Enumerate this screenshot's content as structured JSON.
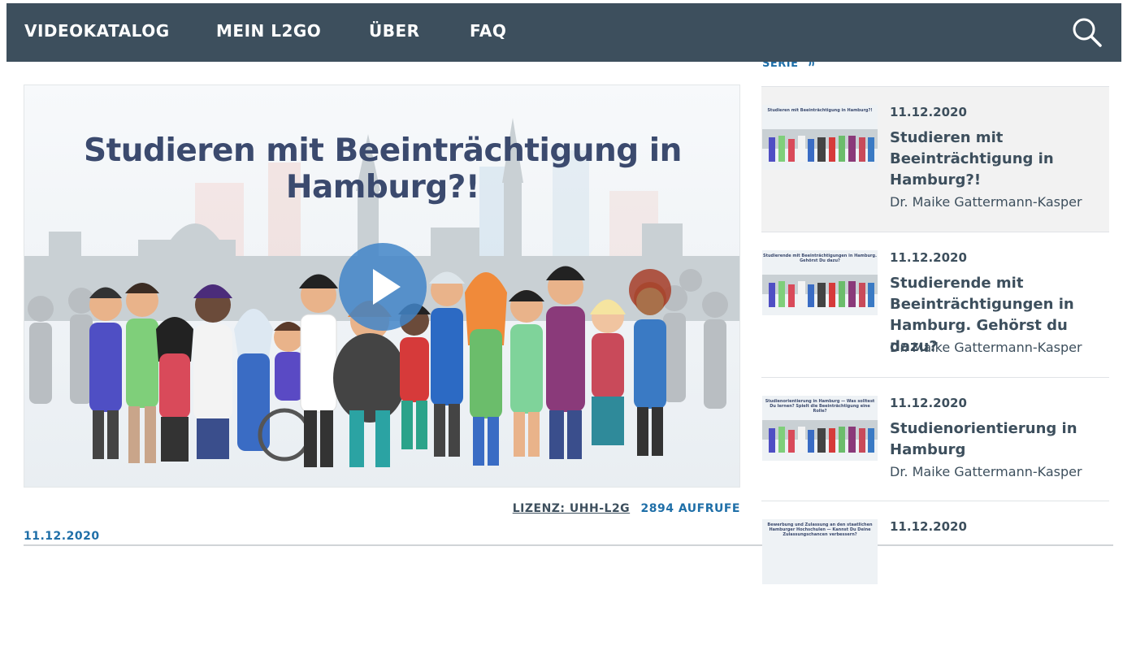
{
  "nav": {
    "items": [
      "VIDEOKATALOG",
      "MEIN L2GO",
      "ÜBER",
      "FAQ"
    ],
    "search_icon": "search-icon"
  },
  "series_link": "SERIE",
  "player": {
    "title": "Studieren mit Beeinträchtigung in Hamburg?!",
    "license": "LIZENZ: UHH-L2G",
    "views": "2894 AUFRUFE",
    "date": "11.12.2020"
  },
  "sidebar": {
    "items": [
      {
        "date": "11.12.2020",
        "title": "Studieren mit Beeinträchtigung in Hamburg?!",
        "author": "Dr. Maike Gattermann-Kasper",
        "thumb_caption": "Studieren mit Beeinträchtigung in Hamburg?!"
      },
      {
        "date": "11.12.2020",
        "title": "Studierende mit Beeinträchtigungen in Hamburg. Gehörst du dazu?",
        "author": "Dr. Maike Gattermann-Kasper",
        "thumb_caption": "Studierende mit Beeinträchtigungen in Hamburg. Gehörst Du dazu?"
      },
      {
        "date": "11.12.2020",
        "title": "Studienorientierung in Hamburg",
        "author": "Dr. Maike Gattermann-Kasper",
        "thumb_caption": "Studienorientierung in Hamburg — Was solltest Du lernen? Spielt die Beeinträchtigung eine Rolle?"
      },
      {
        "date": "11.12.2020",
        "title": "",
        "author": "",
        "thumb_caption": "Bewerbung und Zulassung an den staatlichen Hamburger Hochschulen — Kannst Du Deine Zulassungschancen verbessern?"
      }
    ]
  },
  "colors": {
    "nav_bg": "#3d4f5d",
    "accent_blue": "#1f6fa8",
    "text_dark": "#3d4f5d"
  }
}
